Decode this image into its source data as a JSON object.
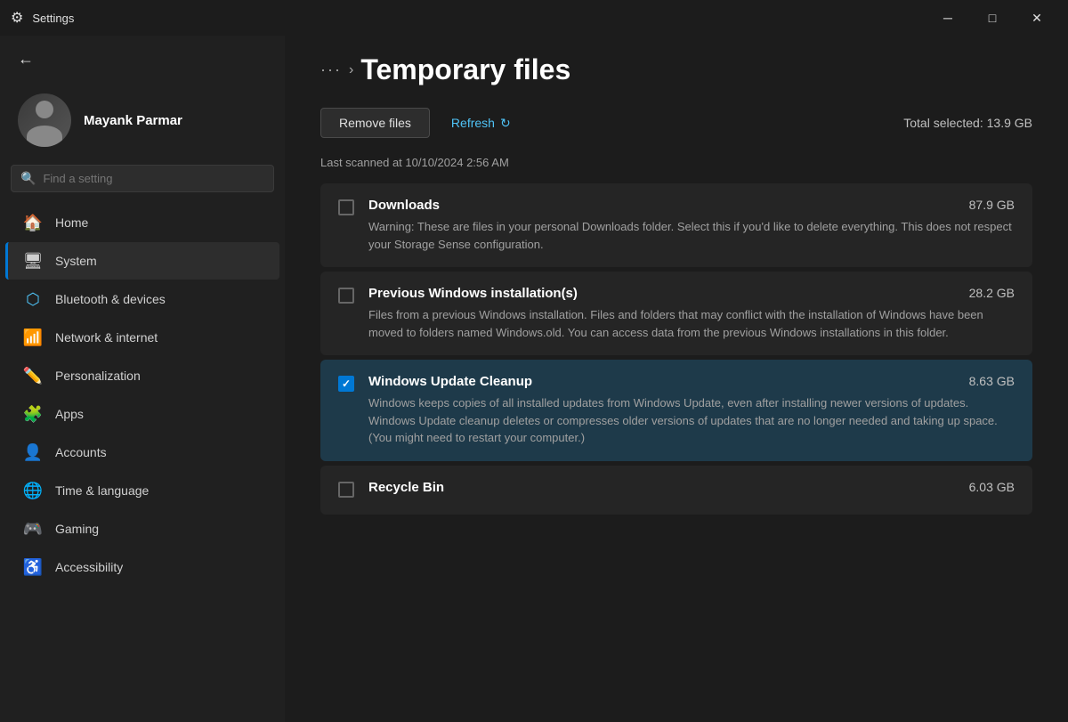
{
  "titlebar": {
    "title": "Settings",
    "minimize_label": "─",
    "maximize_label": "□",
    "close_label": "✕"
  },
  "sidebar": {
    "user": {
      "name": "Mayank Parmar"
    },
    "search": {
      "placeholder": "Find a setting"
    },
    "nav_items": [
      {
        "id": "home",
        "label": "Home",
        "icon": "🏠"
      },
      {
        "id": "system",
        "label": "System",
        "icon": "🖥",
        "active": true
      },
      {
        "id": "bluetooth",
        "label": "Bluetooth & devices",
        "icon": "🔵"
      },
      {
        "id": "network",
        "label": "Network & internet",
        "icon": "📶"
      },
      {
        "id": "personalization",
        "label": "Personalization",
        "icon": "✏️"
      },
      {
        "id": "apps",
        "label": "Apps",
        "icon": "🧩"
      },
      {
        "id": "accounts",
        "label": "Accounts",
        "icon": "👤"
      },
      {
        "id": "time",
        "label": "Time & language",
        "icon": "🌐"
      },
      {
        "id": "gaming",
        "label": "Gaming",
        "icon": "🎮"
      },
      {
        "id": "accessibility",
        "label": "Accessibility",
        "icon": "♿"
      }
    ]
  },
  "content": {
    "breadcrumb_dots": "···",
    "breadcrumb_chevron": "›",
    "title": "Temporary files",
    "toolbar": {
      "remove_files": "Remove files",
      "refresh": "Refresh",
      "refresh_icon": "↻",
      "total_selected": "Total selected: 13.9 GB"
    },
    "scan_info": "Last scanned at 10/10/2024 2:56 AM",
    "file_items": [
      {
        "id": "downloads",
        "name": "Downloads",
        "size": "87.9 GB",
        "description": "Warning: These are files in your personal Downloads folder. Select this if you'd like to delete everything. This does not respect your Storage Sense configuration.",
        "checked": false,
        "selected": false
      },
      {
        "id": "prev-windows",
        "name": "Previous Windows installation(s)",
        "size": "28.2 GB",
        "description": "Files from a previous Windows installation.  Files and folders that may conflict with the installation of Windows have been moved to folders named Windows.old.  You can access data from the previous Windows installations in this folder.",
        "checked": false,
        "selected": false
      },
      {
        "id": "windows-update",
        "name": "Windows Update Cleanup",
        "size": "8.63 GB",
        "description": "Windows keeps copies of all installed updates from Windows Update, even after installing newer versions of updates. Windows Update cleanup deletes or compresses older versions of updates that are no longer needed and taking up space. (You might need to restart your computer.)",
        "checked": true,
        "selected": true
      },
      {
        "id": "recycle-bin",
        "name": "Recycle Bin",
        "size": "6.03 GB",
        "description": "",
        "checked": false,
        "selected": false
      }
    ]
  }
}
